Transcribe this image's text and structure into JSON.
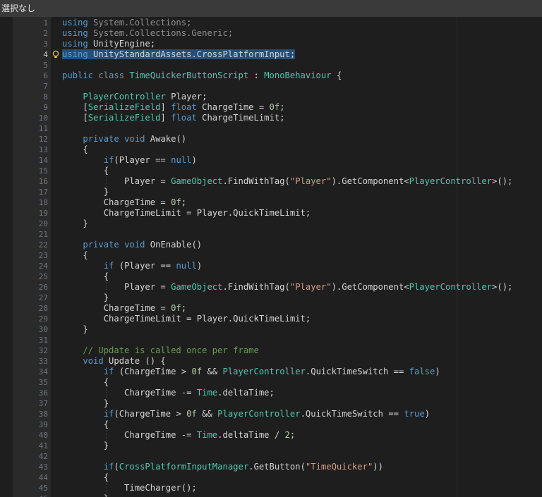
{
  "topbar": {
    "title": "選択なし"
  },
  "gutter": {
    "hint_icon": "lightbulb-icon"
  },
  "lines": [
    {
      "n": "1",
      "tokens": [
        {
          "t": "using",
          "c": "kw"
        },
        {
          "t": " System.Collections;",
          "c": "dim"
        }
      ]
    },
    {
      "n": "2",
      "tokens": [
        {
          "t": "using",
          "c": "kw"
        },
        {
          "t": " System.Collections.Generic;",
          "c": "dim"
        }
      ]
    },
    {
      "n": "3",
      "tokens": [
        {
          "t": "using",
          "c": "kw"
        },
        {
          "t": " UnityEngine;"
        }
      ]
    },
    {
      "n": "4",
      "sel": true,
      "bulb": true,
      "tokens": [
        {
          "t": "using",
          "c": "kw"
        },
        {
          "t": " UnityStandardAssets.CrossPlatformInput;"
        }
      ]
    },
    {
      "n": "5",
      "tokens": []
    },
    {
      "n": "6",
      "tokens": [
        {
          "t": "public",
          "c": "kw"
        },
        {
          "t": " "
        },
        {
          "t": "class",
          "c": "kw"
        },
        {
          "t": " "
        },
        {
          "t": "TimeQuickerButtonScript",
          "c": "ty"
        },
        {
          "t": " : "
        },
        {
          "t": "MonoBehaviour",
          "c": "ty"
        },
        {
          "t": " {"
        }
      ]
    },
    {
      "n": "7",
      "tokens": []
    },
    {
      "n": "8",
      "tokens": [
        {
          "t": "    "
        },
        {
          "t": "PlayerController",
          "c": "ty"
        },
        {
          "t": " Player;"
        }
      ]
    },
    {
      "n": "9",
      "tokens": [
        {
          "t": "    ["
        },
        {
          "t": "SerializeField",
          "c": "ty"
        },
        {
          "t": "] "
        },
        {
          "t": "float",
          "c": "kw"
        },
        {
          "t": " ChargeTime = "
        },
        {
          "t": "0f",
          "c": "nm"
        },
        {
          "t": ";"
        }
      ]
    },
    {
      "n": "10",
      "tokens": [
        {
          "t": "    ["
        },
        {
          "t": "SerializeField",
          "c": "ty"
        },
        {
          "t": "] "
        },
        {
          "t": "float",
          "c": "kw"
        },
        {
          "t": " ChargeTimeLimit;"
        }
      ]
    },
    {
      "n": "11",
      "tokens": []
    },
    {
      "n": "12",
      "tokens": [
        {
          "t": "    "
        },
        {
          "t": "private",
          "c": "kw"
        },
        {
          "t": " "
        },
        {
          "t": "void",
          "c": "kw"
        },
        {
          "t": " Awake()"
        }
      ]
    },
    {
      "n": "13",
      "tokens": [
        {
          "t": "    {"
        }
      ]
    },
    {
      "n": "14",
      "tokens": [
        {
          "t": "        "
        },
        {
          "t": "if",
          "c": "kw"
        },
        {
          "t": "(Player == "
        },
        {
          "t": "null",
          "c": "kw"
        },
        {
          "t": ")"
        }
      ]
    },
    {
      "n": "15",
      "tokens": [
        {
          "t": "        {"
        }
      ]
    },
    {
      "n": "16",
      "tokens": [
        {
          "t": "            Player = "
        },
        {
          "t": "GameObject",
          "c": "ty"
        },
        {
          "t": ".FindWithTag("
        },
        {
          "t": "\"Player\"",
          "c": "st"
        },
        {
          "t": ").GetComponent<"
        },
        {
          "t": "PlayerController",
          "c": "ty"
        },
        {
          "t": ">();"
        }
      ]
    },
    {
      "n": "17",
      "tokens": [
        {
          "t": "        }"
        }
      ]
    },
    {
      "n": "18",
      "tokens": [
        {
          "t": "        ChargeTime = "
        },
        {
          "t": "0f",
          "c": "nm"
        },
        {
          "t": ";"
        }
      ]
    },
    {
      "n": "19",
      "tokens": [
        {
          "t": "        ChargeTimeLimit = Player.QuickTimeLimit;"
        }
      ]
    },
    {
      "n": "20",
      "tokens": [
        {
          "t": "    }"
        }
      ]
    },
    {
      "n": "21",
      "tokens": []
    },
    {
      "n": "22",
      "tokens": [
        {
          "t": "    "
        },
        {
          "t": "private",
          "c": "kw"
        },
        {
          "t": " "
        },
        {
          "t": "void",
          "c": "kw"
        },
        {
          "t": " OnEnable()"
        }
      ]
    },
    {
      "n": "23",
      "tokens": [
        {
          "t": "    {"
        }
      ]
    },
    {
      "n": "24",
      "tokens": [
        {
          "t": "        "
        },
        {
          "t": "if",
          "c": "kw"
        },
        {
          "t": " (Player == "
        },
        {
          "t": "null",
          "c": "kw"
        },
        {
          "t": ")"
        }
      ]
    },
    {
      "n": "25",
      "tokens": [
        {
          "t": "        {"
        }
      ]
    },
    {
      "n": "26",
      "tokens": [
        {
          "t": "            Player = "
        },
        {
          "t": "GameObject",
          "c": "ty"
        },
        {
          "t": ".FindWithTag("
        },
        {
          "t": "\"Player\"",
          "c": "st"
        },
        {
          "t": ").GetComponent<"
        },
        {
          "t": "PlayerController",
          "c": "ty"
        },
        {
          "t": ">();"
        }
      ]
    },
    {
      "n": "27",
      "tokens": [
        {
          "t": "        }"
        }
      ]
    },
    {
      "n": "28",
      "tokens": [
        {
          "t": "        ChargeTime = "
        },
        {
          "t": "0f",
          "c": "nm"
        },
        {
          "t": ";"
        }
      ]
    },
    {
      "n": "29",
      "tokens": [
        {
          "t": "        ChargeTimeLimit = Player.QuickTimeLimit;"
        }
      ]
    },
    {
      "n": "30",
      "tokens": [
        {
          "t": "    }"
        }
      ]
    },
    {
      "n": "31",
      "tokens": []
    },
    {
      "n": "32",
      "tokens": [
        {
          "t": "    "
        },
        {
          "t": "// Update is called once per frame",
          "c": "cm"
        }
      ]
    },
    {
      "n": "33",
      "tokens": [
        {
          "t": "    "
        },
        {
          "t": "void",
          "c": "kw"
        },
        {
          "t": " Update () {"
        }
      ]
    },
    {
      "n": "34",
      "tokens": [
        {
          "t": "        "
        },
        {
          "t": "if",
          "c": "kw"
        },
        {
          "t": " (ChargeTime > "
        },
        {
          "t": "0f",
          "c": "nm"
        },
        {
          "t": " && "
        },
        {
          "t": "PlayerController",
          "c": "ty"
        },
        {
          "t": ".QuickTimeSwitch == "
        },
        {
          "t": "false",
          "c": "kw"
        },
        {
          "t": ")"
        }
      ]
    },
    {
      "n": "35",
      "tokens": [
        {
          "t": "        {"
        }
      ]
    },
    {
      "n": "36",
      "tokens": [
        {
          "t": "            ChargeTime -= "
        },
        {
          "t": "Time",
          "c": "ty"
        },
        {
          "t": ".deltaTime;"
        }
      ]
    },
    {
      "n": "37",
      "tokens": [
        {
          "t": "        }"
        }
      ]
    },
    {
      "n": "38",
      "tokens": [
        {
          "t": "        "
        },
        {
          "t": "if",
          "c": "kw"
        },
        {
          "t": "(ChargeTime > "
        },
        {
          "t": "0f",
          "c": "nm"
        },
        {
          "t": " && "
        },
        {
          "t": "PlayerController",
          "c": "ty"
        },
        {
          "t": ".QuickTimeSwitch == "
        },
        {
          "t": "true",
          "c": "kw"
        },
        {
          "t": ")"
        }
      ]
    },
    {
      "n": "39",
      "tokens": [
        {
          "t": "        {"
        }
      ]
    },
    {
      "n": "40",
      "tokens": [
        {
          "t": "            ChargeTime -= "
        },
        {
          "t": "Time",
          "c": "ty"
        },
        {
          "t": ".deltaTime / "
        },
        {
          "t": "2",
          "c": "nm"
        },
        {
          "t": ";"
        }
      ]
    },
    {
      "n": "41",
      "tokens": [
        {
          "t": "        }"
        }
      ]
    },
    {
      "n": "42",
      "tokens": []
    },
    {
      "n": "43",
      "tokens": [
        {
          "t": "        "
        },
        {
          "t": "if",
          "c": "kw"
        },
        {
          "t": "("
        },
        {
          "t": "CrossPlatformInputManager",
          "c": "ty"
        },
        {
          "t": ".GetButton("
        },
        {
          "t": "\"TimeQuicker\"",
          "c": "st"
        },
        {
          "t": "))"
        }
      ]
    },
    {
      "n": "44",
      "tokens": [
        {
          "t": "        {"
        }
      ]
    },
    {
      "n": "45",
      "tokens": [
        {
          "t": "            TimeCharger();"
        }
      ]
    },
    {
      "n": "46",
      "tokens": [
        {
          "t": "        }"
        }
      ]
    }
  ]
}
